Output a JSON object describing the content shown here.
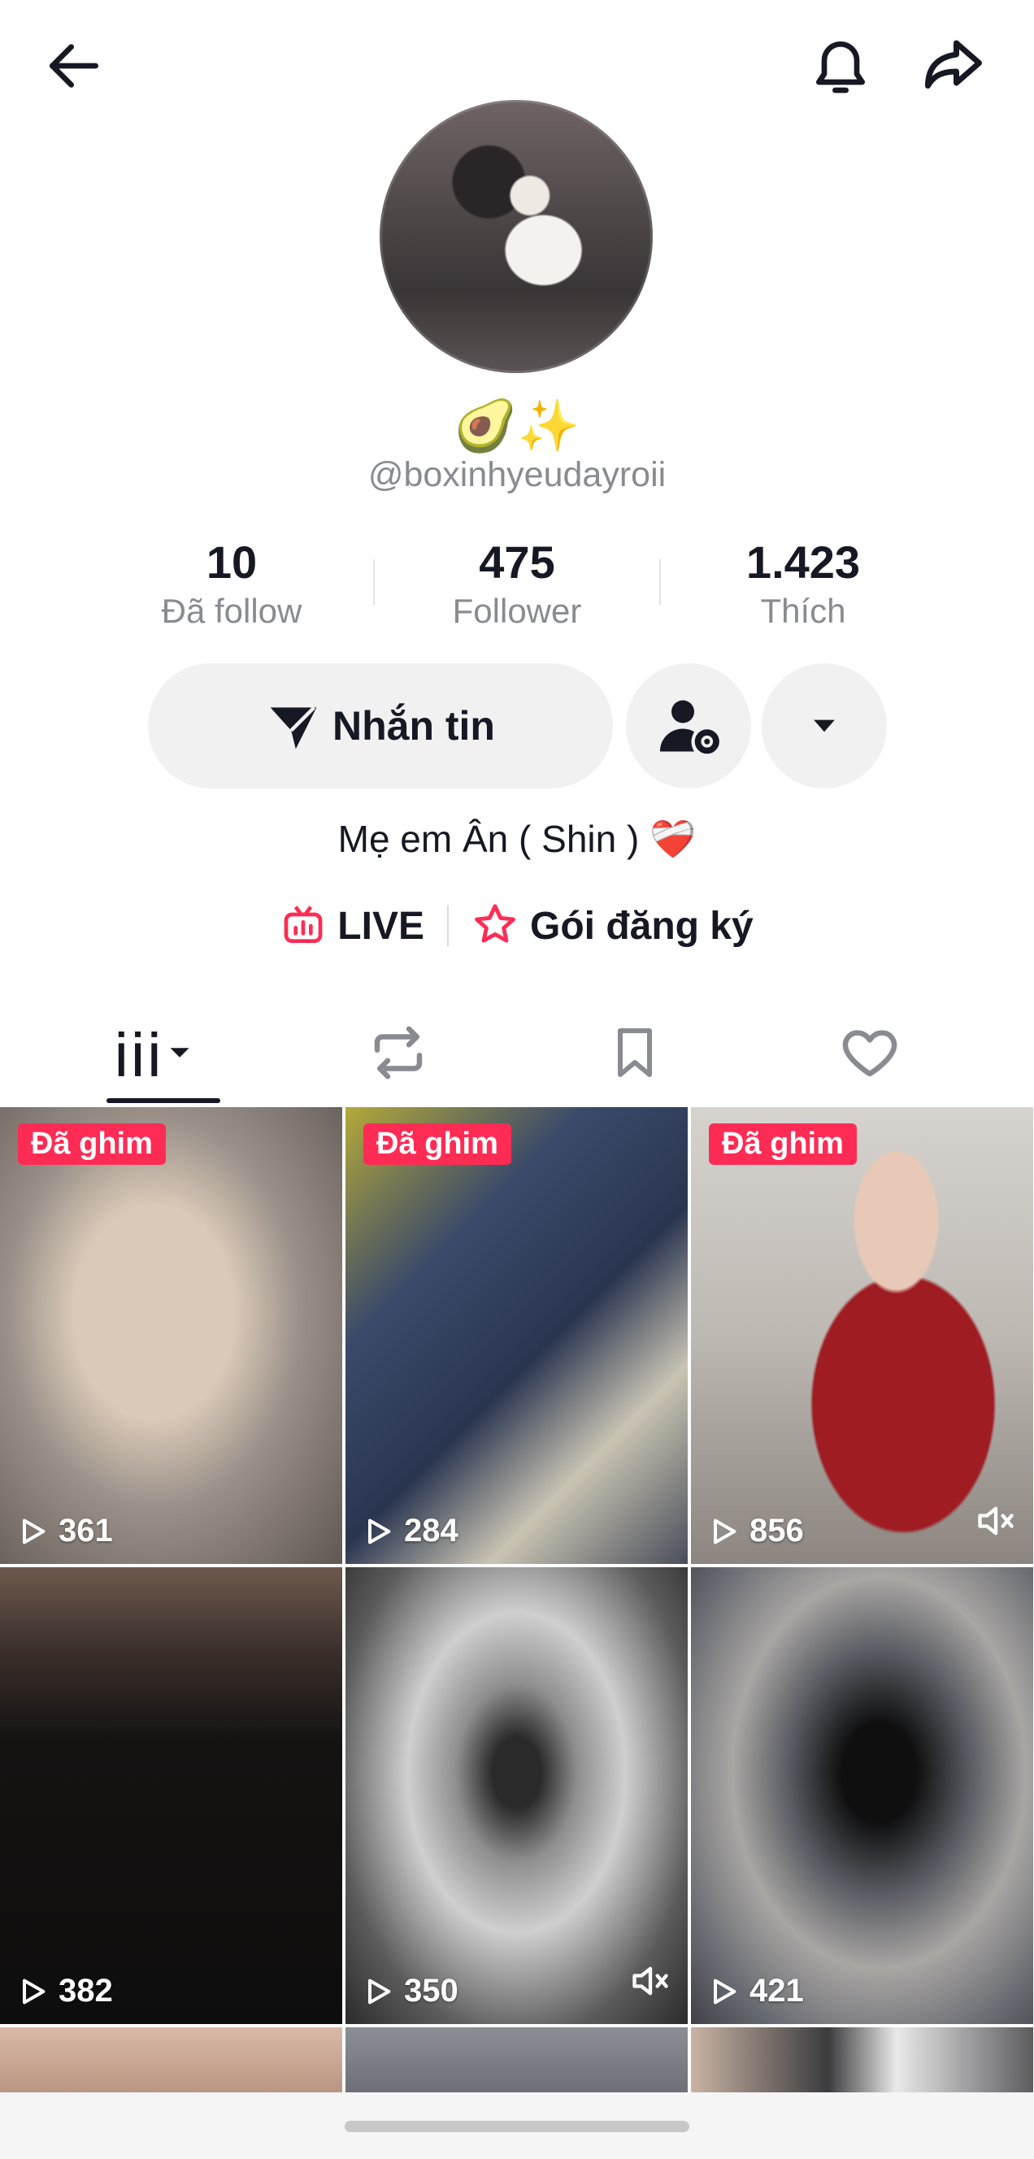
{
  "profile": {
    "emoji": "🥑✨",
    "username": "@boxinhyeudayroii",
    "bio": "Mẹ em Ân ( Shin ) ❤️‍🩹"
  },
  "stats": [
    {
      "value": "10",
      "label": "Đã follow"
    },
    {
      "value": "475",
      "label": "Follower"
    },
    {
      "value": "1.423",
      "label": "Thích"
    }
  ],
  "actions": {
    "message_label": "Nhắn tin"
  },
  "links": {
    "live_label": "LIVE",
    "subscription_label": "Gói đăng ký"
  },
  "colors": {
    "accent": "#fe2c55",
    "text": "#161823",
    "muted": "#8a8b91",
    "button_bg": "#f1f1f2"
  },
  "videos": [
    {
      "pinned_label": "Đã ghim",
      "views": "361",
      "muted": false
    },
    {
      "pinned_label": "Đã ghim",
      "views": "284",
      "muted": false
    },
    {
      "pinned_label": "Đã ghim",
      "views": "856",
      "muted": true
    },
    {
      "pinned_label": "",
      "views": "382",
      "muted": false
    },
    {
      "pinned_label": "",
      "views": "350",
      "muted": true
    },
    {
      "pinned_label": "",
      "views": "421",
      "muted": false
    }
  ]
}
